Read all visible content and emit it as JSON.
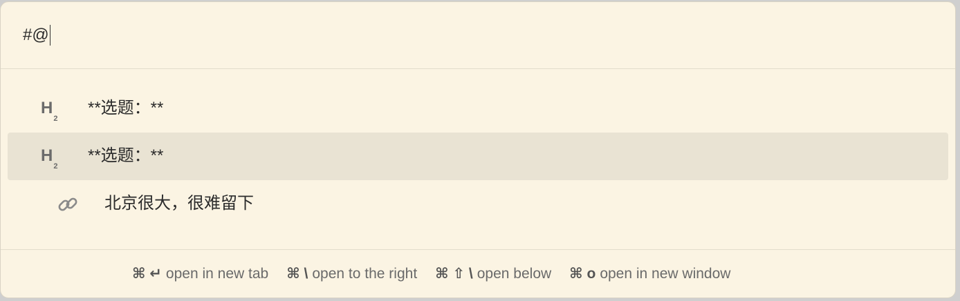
{
  "search": {
    "value": "#@"
  },
  "results": [
    {
      "icon": "heading-2-icon",
      "heading_letter": "H",
      "heading_level": "2",
      "text": "**选题：**"
    },
    {
      "icon": "heading-2-icon",
      "heading_letter": "H",
      "heading_level": "2",
      "text": "**选题：**",
      "selected": true
    },
    {
      "icon": "link-icon",
      "text": "北京很大，很难留下"
    }
  ],
  "footer": {
    "hints": [
      {
        "keys": "⌘ ↵",
        "label": "open in new tab"
      },
      {
        "keys": "⌘ \\",
        "label": "open to the right"
      },
      {
        "keys": "⌘ ⇧ \\",
        "label": "open below"
      },
      {
        "keys": "⌘ o",
        "label": "open in new window"
      }
    ]
  },
  "colors": {
    "background": "#fbf4e3",
    "selected_row": "#e9e3d3",
    "border": "#e2dccb"
  }
}
